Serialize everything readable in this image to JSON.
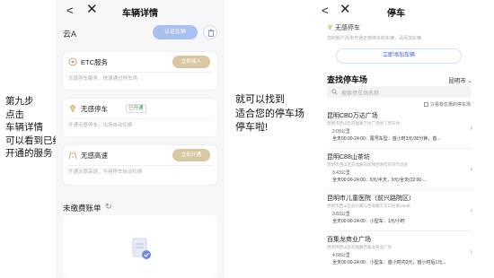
{
  "caption_left": [
    "第九步",
    "点击",
    "车辆详情",
    "可以看到已经",
    "开通的服务"
  ],
  "caption_mid": [
    "就可以找到",
    "适合您的停车场",
    "停车啦!"
  ],
  "left_phone": {
    "back_glyph": "<",
    "close_glyph": "✕",
    "title": "车辆详情",
    "plate_prefix": "云A",
    "auth_button": "认证车辆",
    "services": [
      {
        "name": "ETC服务",
        "tag": "",
        "action": "立即接入",
        "desc": "无感停车服务，快速通过停车场"
      },
      {
        "name": "无感停车",
        "tag": "已开通",
        "action": "",
        "desc": "开通无感停车，出场自动扣费"
      },
      {
        "name": "无感高速",
        "tag": "",
        "action": "立即开通",
        "desc": "开通无感高速，不用停车自动扣费"
      }
    ],
    "bill_title": "未缴费账单",
    "refresh_glyph": "↻"
  },
  "right_phone": {
    "back_glyph": "<",
    "close_glyph": "✕",
    "title": "停车",
    "noplate_title": "无感停车",
    "noplate_desc": "您的账户尚未开通无感停车的车辆，请添加车辆",
    "add_plate": "立即添加车辆",
    "find_title": "查找停车场",
    "city": "昆明市",
    "search_placeholder": "搜索停车场名称",
    "only_discount": "只看有优惠的停车场",
    "lots": [
      {
        "name": "昆明CBD万达广场",
        "addr": "昆明市西山区前福路万达广场地下停车场",
        "dist": "2.09公里",
        "fee": "全天00:00-24:00：尾号车型：首小时3元/30分钟，首..."
      },
      {
        "name": "昆明C88山茶坊",
        "addr": "昆明市西山区前福路东延线昆明市花鸟市场旁",
        "dist": "3.43公里",
        "fee": "全天00:00-24:00：5元/半天，9元/全天(22:00-..."
      },
      {
        "name": "昆明市儿童医院（前兴路院区）",
        "addr": "昆明市西山区前兴路与西坝路交叉口往南250米",
        "dist": "3.83公里",
        "fee": "全天00:00-24:00：小型车：1元/小时"
      },
      {
        "name": "百集龙商业广场",
        "addr": "昆明市西山区前福路百集龙商业广场",
        "dist": "4.68公里",
        "fee": "全天00:00-24:00：小型车：首小时内3元，首小时后1元..."
      }
    ]
  },
  "colors": {
    "auth_btn": "#a8bff2",
    "service_pill": "#d9c7a4",
    "link_blue": "#3a5fd0"
  }
}
